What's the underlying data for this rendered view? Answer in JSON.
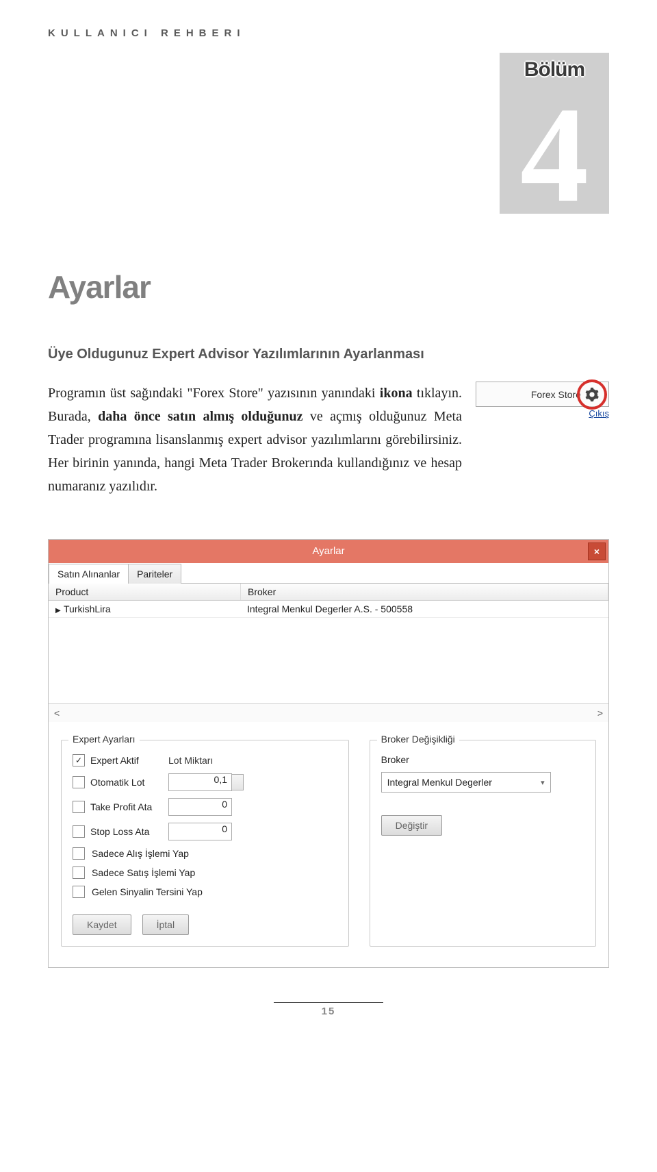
{
  "header_line": "KULLANICI REHBERI",
  "chapter": {
    "label": "Bölüm",
    "number": "4"
  },
  "title": "Ayarlar",
  "subheading": "Üye Oldugunuz Expert Advisor Yazılımlarının Ayarlanması",
  "body_p1_a": "Programın üst sağındaki \"Forex Store\" yazısının yanındaki ",
  "body_p1_b": "ikona",
  "body_p1_c": " tıklayın. Burada, ",
  "body_p1_d": "daha önce satın almış olduğunuz",
  "body_p1_e": " ve açmış olduğunuz Meta Trader programına lisanslanmış expert advisor yazılımlarını görebilirsiniz. Her birinin yanında, hangi Meta Trader Brokerında kullandığınız ve hesap numaranız yazılıdır.",
  "store_button": {
    "label": "Forex Store",
    "cikis": "Çıkış"
  },
  "dialog": {
    "title": "Ayarlar",
    "tabs": [
      "Satın Alınanlar",
      "Pariteler"
    ],
    "columns": [
      "Product",
      "Broker"
    ],
    "rows": [
      {
        "product": "TurkishLira",
        "broker": "Integral Menkul Degerler A.S. - 500558"
      }
    ],
    "scroll_left": "<",
    "scroll_right": ">",
    "panel_left": {
      "title": "Expert Ayarları",
      "lot_label": "Lot Miktarı",
      "lot_value": "0,1",
      "options": [
        {
          "key": "expert_aktif",
          "label": "Expert Aktif",
          "checked": true
        },
        {
          "key": "otomatik_lot",
          "label": "Otomatik Lot",
          "checked": false
        },
        {
          "key": "take_profit",
          "label": "Take Profit Ata",
          "checked": false,
          "value": "0"
        },
        {
          "key": "stop_loss",
          "label": "Stop Loss Ata",
          "checked": false,
          "value": "0"
        },
        {
          "key": "sadece_alis",
          "label": "Sadece Alış İşlemi Yap",
          "checked": false
        },
        {
          "key": "sadece_satis",
          "label": "Sadece Satış İşlemi Yap",
          "checked": false
        },
        {
          "key": "ters_sinyal",
          "label": "Gelen Sinyalin Tersini Yap",
          "checked": false
        }
      ],
      "save": "Kaydet",
      "cancel": "İptal"
    },
    "panel_right": {
      "title": "Broker Değişikliği",
      "broker_label": "Broker",
      "broker_value": "Integral Menkul Degerler",
      "change": "Değiştir"
    }
  },
  "page_number": "15"
}
